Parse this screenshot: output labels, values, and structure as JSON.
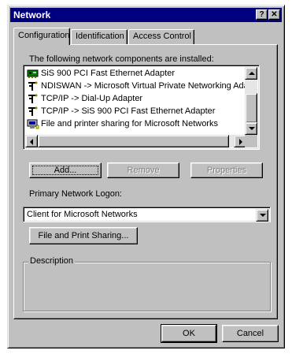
{
  "window": {
    "title": "Network",
    "help_button": "?",
    "close_button": "✕"
  },
  "tabs": [
    {
      "label": "Configuration",
      "active": true
    },
    {
      "label": "Identification",
      "active": false
    },
    {
      "label": "Access Control",
      "active": false
    }
  ],
  "components": {
    "label": "The following network components are installed:",
    "items": [
      {
        "icon": "network-adapter-icon",
        "label": "SiS 900 PCI Fast Ethernet Adapter"
      },
      {
        "icon": "protocol-icon",
        "label": "NDISWAN -> Microsoft Virtual Private Networking Adapte"
      },
      {
        "icon": "protocol-icon",
        "label": "TCP/IP -> Dial-Up Adapter"
      },
      {
        "icon": "protocol-icon",
        "label": "TCP/IP -> SiS 900 PCI Fast Ethernet Adapter"
      },
      {
        "icon": "file-sharing-icon",
        "label": "File and printer sharing for Microsoft Networks"
      }
    ]
  },
  "buttons": {
    "add": "Add...",
    "remove": "Remove",
    "properties": "Properties",
    "file_print_sharing": "File and Print Sharing...",
    "ok": "OK",
    "cancel": "Cancel"
  },
  "logon": {
    "label": "Primary Network Logon:",
    "value": "Client for Microsoft Networks"
  },
  "description": {
    "label": "Description"
  },
  "colors": {
    "face": "#c0c0c0",
    "titlebar": "#000080"
  }
}
